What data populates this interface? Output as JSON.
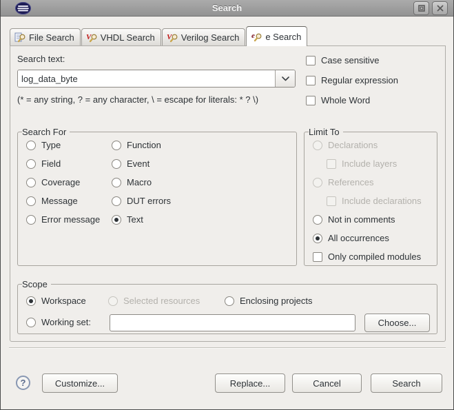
{
  "window": {
    "title": "Search"
  },
  "tabs": [
    {
      "label": "File Search",
      "active": false
    },
    {
      "label": "VHDL Search",
      "active": false
    },
    {
      "label": "Verilog Search",
      "active": false
    },
    {
      "label": "e Search",
      "active": true
    }
  ],
  "search_section": {
    "label": "Search text:",
    "input_value": "log_data_byte",
    "hint": "(* = any string, ? = any character, \\ = escape for literals: * ? \\)"
  },
  "options": [
    {
      "label": "Case sensitive",
      "checked": false
    },
    {
      "label": "Regular expression",
      "checked": false
    },
    {
      "label": "Whole Word",
      "checked": false
    }
  ],
  "search_for": {
    "title": "Search For",
    "column1": [
      "Type",
      "Field",
      "Coverage",
      "Message",
      "Error message"
    ],
    "column2": [
      "Function",
      "Event",
      "Macro",
      "DUT errors",
      "Text"
    ],
    "selected": "Text"
  },
  "limit_to": {
    "title": "Limit To",
    "items": [
      {
        "label": "Declarations",
        "type": "radio",
        "disabled": true,
        "checked": false,
        "indent": false
      },
      {
        "label": "Include layers",
        "type": "checkbox",
        "disabled": true,
        "checked": false,
        "indent": true
      },
      {
        "label": "References",
        "type": "radio",
        "disabled": true,
        "checked": false,
        "indent": false
      },
      {
        "label": "Include declarations",
        "type": "checkbox",
        "disabled": true,
        "checked": false,
        "indent": true
      },
      {
        "label": "Not in comments",
        "type": "radio",
        "disabled": false,
        "checked": false,
        "indent": false
      },
      {
        "label": "All occurrences",
        "type": "radio",
        "disabled": false,
        "checked": true,
        "indent": false
      },
      {
        "label": "Only compiled modules",
        "type": "checkbox",
        "disabled": false,
        "checked": false,
        "indent": false
      }
    ]
  },
  "scope": {
    "title": "Scope",
    "row1": [
      {
        "label": "Workspace",
        "checked": true,
        "disabled": false
      },
      {
        "label": "Selected resources",
        "checked": false,
        "disabled": true
      },
      {
        "label": "Enclosing projects",
        "checked": false,
        "disabled": false
      }
    ],
    "working_set": {
      "label": "Working set:",
      "checked": false,
      "value": "",
      "choose_label": "Choose..."
    }
  },
  "footer": {
    "customize": "Customize...",
    "replace": "Replace...",
    "cancel": "Cancel",
    "search": "Search"
  }
}
